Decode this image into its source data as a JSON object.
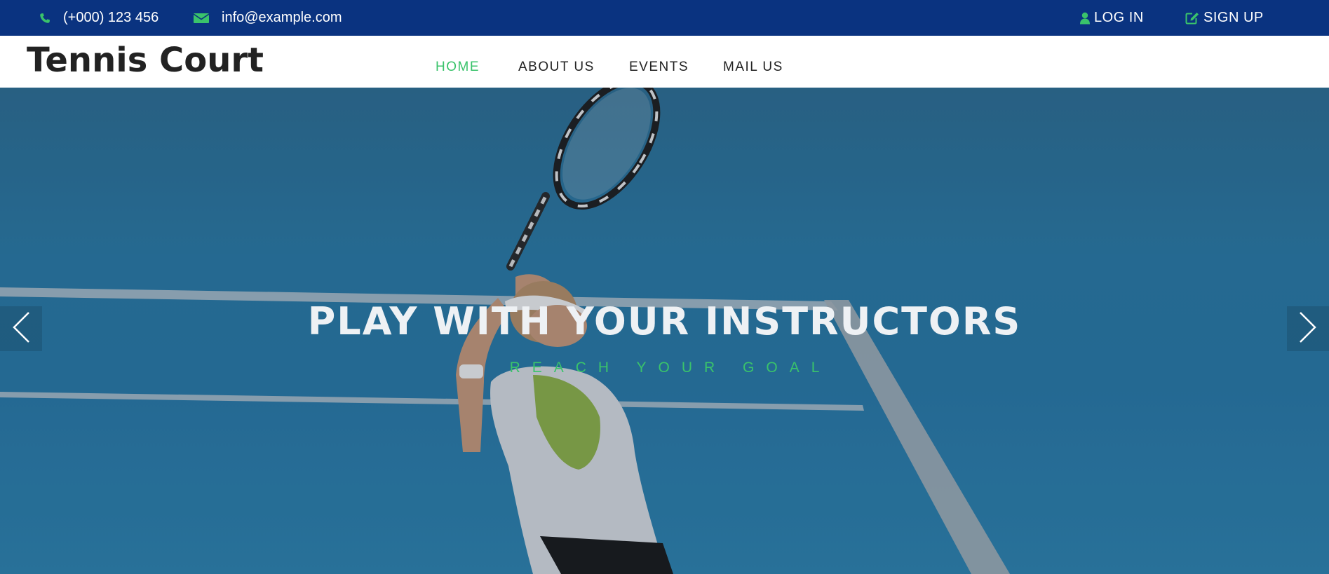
{
  "topbar": {
    "phone": "(+000) 123 456",
    "email": "info@example.com",
    "login_label": "LOG IN",
    "signup_label": "SIGN UP",
    "icons": {
      "phone": "phone-icon",
      "email": "envelope-icon",
      "login": "user-icon",
      "signup": "edit-icon"
    },
    "background_color": "#0a3380",
    "icon_color": "#3ac36b"
  },
  "navbar": {
    "brand": "Tennis Court",
    "links": [
      {
        "label": "HOME",
        "active": true
      },
      {
        "label": "ABOUT US",
        "active": false
      },
      {
        "label": "EVENTS",
        "active": false
      },
      {
        "label": "MAIL US",
        "active": false
      }
    ],
    "accent_color": "#3ac36b"
  },
  "hero": {
    "title": "PLAY WITH YOUR INSTRUCTORS",
    "subtitle": "REACH YOUR GOAL",
    "prev_icon": "chevron-left-icon",
    "next_icon": "chevron-right-icon"
  }
}
